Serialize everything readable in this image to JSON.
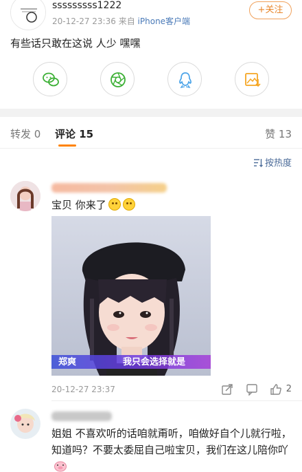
{
  "post": {
    "username": "sssssssss1222",
    "time": "20-12-27 23:36",
    "source_prefix": "来自",
    "source": "iPhone客户端",
    "follow_label": "+关注",
    "text": "有些话只敢在这说 人少 嘿嘿"
  },
  "share": [
    {
      "icon": "wechat-icon",
      "color": "#3cb035"
    },
    {
      "icon": "moments-icon",
      "color": "#3cb035"
    },
    {
      "icon": "qq-icon",
      "color": "#4aa3e8"
    },
    {
      "icon": "save-image-icon",
      "color": "#f5a623"
    }
  ],
  "tabs": {
    "repost_label": "转发 0",
    "comment_label": "评论 15",
    "like_label": "赞 13"
  },
  "sort_label": "按热度",
  "comments": [
    {
      "text": "宝贝 你来了",
      "image_caption_name": "郑爽",
      "image_caption_line": "我只会选择就是",
      "time": "20-12-27 23:37",
      "likes": "2"
    },
    {
      "text": "姐姐 不喜欢听的话咱就甭听，咱做好自个儿就行啦，知道吗？不要太委屈自己啦宝贝，我们在这儿陪你吖"
    }
  ]
}
